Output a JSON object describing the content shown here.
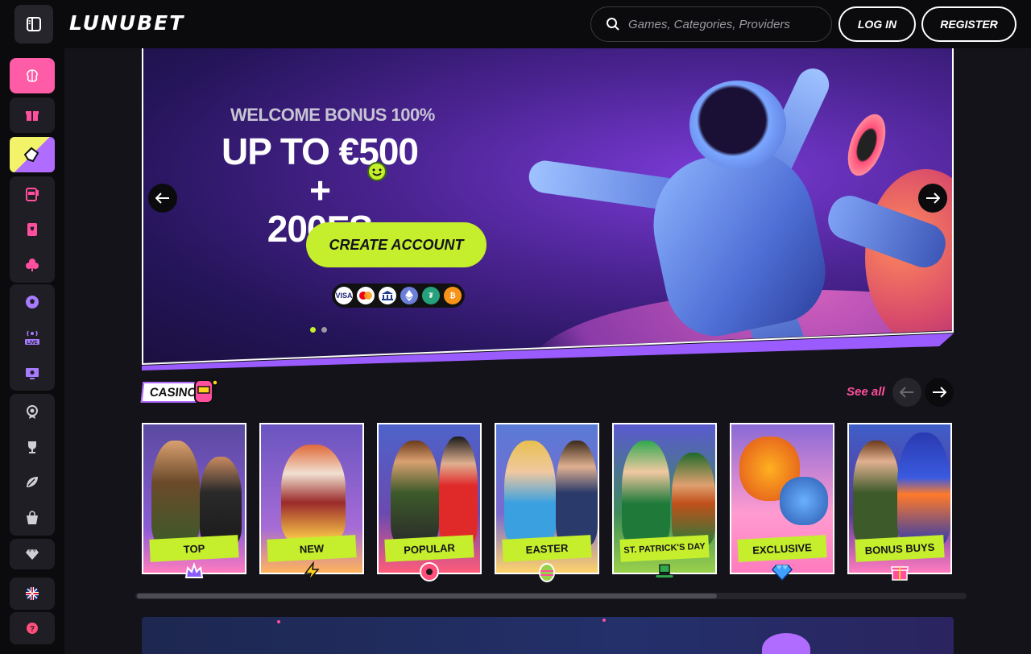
{
  "header": {
    "logo": "LUNUBET",
    "search_placeholder": "Games, Categories, Providers",
    "login_label": "LOG IN",
    "register_label": "REGISTER"
  },
  "sidebar": {
    "groups": [
      {
        "items": [
          {
            "icon": "brain-icon",
            "active": true
          }
        ]
      },
      {
        "items": [
          {
            "icon": "gift-icon"
          }
        ]
      },
      {
        "items": [
          {
            "icon": "promo-hand-icon",
            "active": true
          }
        ]
      },
      {
        "items": [
          {
            "icon": "slot-machine-icon"
          },
          {
            "icon": "card-icon"
          },
          {
            "icon": "clover-icon"
          }
        ]
      },
      {
        "items": [
          {
            "icon": "soccer-ball-icon"
          },
          {
            "icon": "live-icon",
            "label": "LIVE"
          },
          {
            "icon": "esports-icon"
          }
        ]
      },
      {
        "items": [
          {
            "icon": "badge-icon"
          },
          {
            "icon": "trophy-icon"
          },
          {
            "icon": "leaf-icon"
          },
          {
            "icon": "shop-bag-icon"
          }
        ]
      },
      {
        "items": [
          {
            "icon": "diamond-icon"
          }
        ]
      },
      {
        "items": [
          {
            "icon": "uk-flag-icon"
          }
        ]
      },
      {
        "items": [
          {
            "icon": "help-icon"
          }
        ]
      }
    ]
  },
  "hero": {
    "welcome": "WELCOME BONUS 100%",
    "amount_line1": "UP TO €500 +",
    "amount_line2": "200FS",
    "cta_label": "CREATE ACCOUNT",
    "payments": [
      {
        "name": "VISA",
        "color": "#ffffff",
        "text_color": "#1a1f71"
      },
      {
        "name": "mastercard",
        "color": "#ffffff"
      },
      {
        "name": "bank",
        "color": "#ffffff"
      },
      {
        "name": "ethereum",
        "color": "#6c7fd8"
      },
      {
        "name": "tether",
        "color": "#26a17b"
      },
      {
        "name": "bitcoin",
        "color": "#f7931a"
      }
    ],
    "slide_count": 2,
    "active_slide": 1
  },
  "casino": {
    "tag": "CASINO",
    "see_all": "See all",
    "categories": [
      {
        "label": "TOP",
        "bg": "#6b4aa8",
        "badge": "crown-icon",
        "badge_color": "#8a5cff"
      },
      {
        "label": "NEW",
        "bg": "#7a4bc0",
        "badge": "lightning-icon",
        "badge_color": "#ffd21f"
      },
      {
        "label": "POPULAR",
        "bg": "#4d63c9",
        "badge": "donut-icon",
        "badge_color": "#ff4f7a"
      },
      {
        "label": "EASTER",
        "bg": "#5a7ad6",
        "badge": "easter-egg-icon",
        "badge_color": "#9ad14b"
      },
      {
        "label": "ST. PATRICK'S DAY",
        "bg": "#3f8c5a",
        "badge": "leprechaun-hat-icon",
        "badge_color": "#2fa84f"
      },
      {
        "label": "EXCLUSIVE",
        "bg": "#ff7bbf",
        "badge": "gem-icon",
        "badge_color": "#3fa0ff"
      },
      {
        "label": "BONUS BUYS",
        "bg": "#3f5ec8",
        "badge": "gift-box-icon",
        "badge_color": "#ff4f9e"
      }
    ]
  },
  "colors": {
    "accent_green": "#c5ee2c",
    "accent_pink": "#ff4f9e",
    "background": "#141319"
  }
}
